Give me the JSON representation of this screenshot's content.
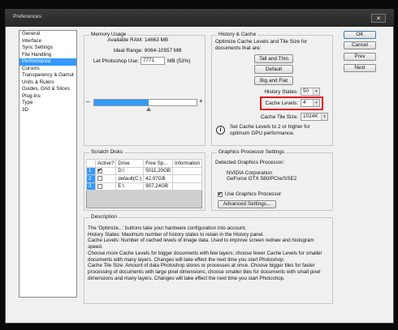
{
  "window": {
    "title": "Preferences",
    "close_label": "✕"
  },
  "nav": {
    "items": [
      "General",
      "Interface",
      "Sync Settings",
      "File Handling",
      "Performance",
      "Cursors",
      "Transparency & Gamut",
      "Units & Rulers",
      "Guides, Grid & Slices",
      "Plug-Ins",
      "Type",
      "3D"
    ],
    "selected_index": 4
  },
  "actions": {
    "ok": "OK",
    "cancel": "Cancel",
    "prev": "Prev",
    "next": "Next"
  },
  "memory": {
    "title": "Memory Usage",
    "available_label": "Available RAM:",
    "available_value": "14663 MB",
    "ideal_label": "Ideal Range:",
    "ideal_value": "8064-10557 MB",
    "let_label": "Let Photoshop Use:",
    "let_value": "7771",
    "let_unit": "MB (53%)",
    "slider_minus": "–",
    "slider_plus": "+",
    "slider_fraction": 0.53
  },
  "history": {
    "title": "History & Cache",
    "intro": "Optimize Cache Levels and Tile Size for documents that are:",
    "btn_tall_thin": "Tall and Thin",
    "btn_default": "Default",
    "btn_big_flat": "Big and Flat",
    "states_label": "History States:",
    "states_value": "50",
    "levels_label": "Cache Levels:",
    "levels_value": "4",
    "tile_label": "Cache Tile Size:",
    "tile_value": "1024K",
    "tip": "Set Cache Levels to 2 or higher for optimum GPU performance.",
    "highlight_color": "#e0161b"
  },
  "scratch": {
    "title": "Scratch Disks",
    "headers": [
      "Active?",
      "Drive",
      "Free Sp...",
      "Information"
    ],
    "rows": [
      {
        "num": "1",
        "active": true,
        "drive": "D:\\",
        "free": "5011,20GB",
        "info": ""
      },
      {
        "num": "2",
        "active": false,
        "drive": "default(C:)",
        "free": "42,97GB",
        "info": ""
      },
      {
        "num": "3",
        "active": false,
        "drive": "E:\\",
        "free": "907,24GB",
        "info": ""
      }
    ]
  },
  "gpu": {
    "title": "Graphics Processor Settings",
    "detected_label": "Detected Graphics Processor:",
    "name_line1": "NVIDIA Corporation",
    "name_line2": "GeForce GTX 580/PCIe/SSE2",
    "use_label": "Use Graphics Processor",
    "use_checked": true,
    "advanced": "Advanced Settings..."
  },
  "description": {
    "title": "Description",
    "text": "The 'Optimize...' buttons take your hardware configuration into account.\nHistory States: Maximum number of history states to retain in the History panel.\nCache Levels: Number of cached levels of image data.  Used to improve screen redraw and histogram speed.\nChoose more Cache Levels for bigger documents with few layers; choose fewer Cache Levels for smaller documents with many layers. Changes will take effect the next time you start Photoshop.\nCache Tile Size: Amount of data Photoshop stores or processes at once. Choose bigger tiles for faster processing of documents with large pixel dimensions; choose smaller tiles for documents with small pixel dimensions and many layers. Changes will take effect the next time you start Photoshop."
  }
}
